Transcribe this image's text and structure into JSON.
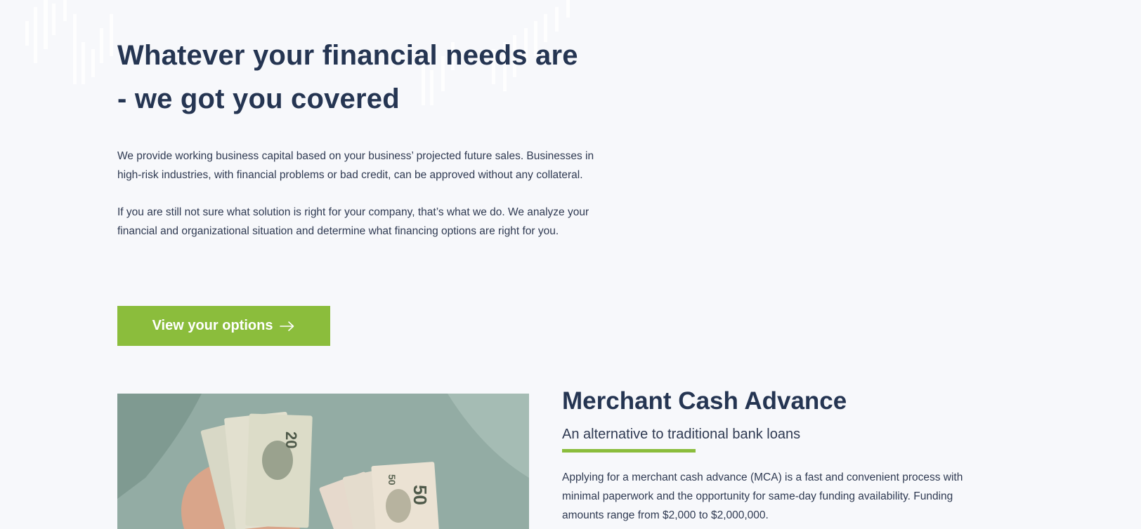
{
  "hero": {
    "title_line1": "Whatever your financial needs are",
    "title_line2": "- we got you covered",
    "paragraph1": "We provide working business capital based on your business’ projected future sales. Businesses in high-risk industries, with financial problems or bad credit, can be approved without any collateral.",
    "paragraph2": "If you are still not sure what solution is right for your company, that’s what we do. We analyze your financial and organizational situation and determine what financing options are right for you."
  },
  "cta": {
    "label": "View your options",
    "icon": "arrow-right-icon"
  },
  "mca": {
    "title": "Merchant Cash Advance",
    "subtitle": "An alternative to traditional bank loans",
    "paragraph": "Applying for a merchant cash advance (MCA) is a fast and convenient process with minimal paperwork and the opportunity for same-day funding availability. Funding amounts range from $2,000 to $2,000,000."
  },
  "colors": {
    "accent": "#8bbd3c",
    "heading": "#253552",
    "text": "#2f3a52",
    "background": "#f7f8fb"
  }
}
